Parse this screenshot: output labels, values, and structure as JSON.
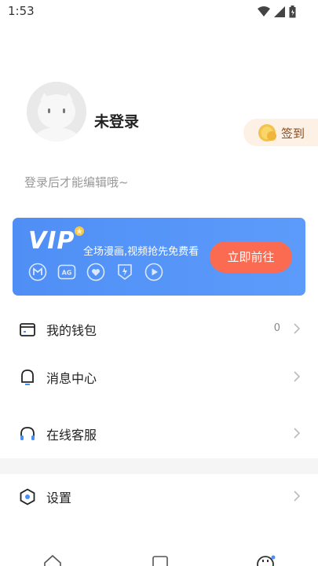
{
  "status": {
    "time": "1:53"
  },
  "profile": {
    "name": "未登录",
    "bio_hint": "登录后才能编辑哦~"
  },
  "signin": {
    "label": "签到"
  },
  "vip": {
    "logo": "VIP",
    "description": "全场漫画,视频抢先免费看",
    "cta": "立即前往",
    "icons": [
      "comic-icon",
      "animation-icon",
      "heart-icon",
      "trophy-icon",
      "play-icon"
    ]
  },
  "menu": {
    "items": [
      {
        "label": "我的钱包",
        "count": "0",
        "icon": "wallet-icon"
      },
      {
        "label": "消息中心",
        "icon": "bell-icon"
      },
      {
        "label": "在线客服",
        "icon": "headset-icon"
      },
      {
        "label": "设置",
        "icon": "settings-icon"
      }
    ]
  },
  "bottom_nav": {
    "icons": [
      "home-icon",
      "bookshelf-icon",
      "profile-icon"
    ]
  },
  "colors": {
    "vip_blue": "#5095f8",
    "cta_orange": "#fb6b51",
    "signin_bg": "#fdf0e4"
  }
}
